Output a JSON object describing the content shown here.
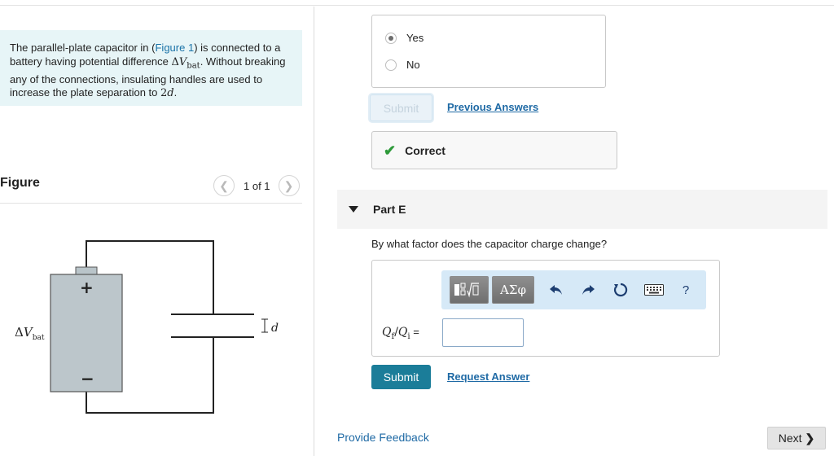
{
  "problem": {
    "text_before_link": "The parallel-plate capacitor in (",
    "link_label": "Figure 1",
    "text_after_link": ") is connected to a battery having potential difference ",
    "vbat_delta": "Δ",
    "vbat_symbol": "V",
    "vbat_sub": "bat",
    "text_mid": ". Without breaking any of the connections, insulating handles are used to increase the plate separation to ",
    "sep_value": "2",
    "sep_var": "d",
    "text_end": "."
  },
  "figure": {
    "label": "Figure",
    "pager_count": "1 of 1",
    "diagram": {
      "battery_plus": "+",
      "battery_minus": "−",
      "voltage_delta": "Δ",
      "voltage_symbol": "V",
      "voltage_sub": "bat",
      "gap_label": "d"
    }
  },
  "previous_part": {
    "options": [
      {
        "label": "Yes",
        "selected": true
      },
      {
        "label": "No",
        "selected": false
      }
    ],
    "submit_label": "Submit",
    "previous_answers_label": "Previous Answers",
    "result_label": "Correct"
  },
  "part_e": {
    "title": "Part E",
    "question": "By what factor does the capacitor charge change?",
    "toolbar": {
      "template_icons": "template-fraction-sqrt",
      "greek_label": "ΑΣφ",
      "help_label": "?"
    },
    "answer_q": "Q",
    "answer_f": "f",
    "answer_slash": "/",
    "answer_i": "i",
    "answer_eq": "=",
    "answer_value": "",
    "submit_label": "Submit",
    "request_answer_label": "Request Answer"
  },
  "footer": {
    "feedback_label": "Provide Feedback",
    "next_label": "Next"
  },
  "colors": {
    "link": "#1f6aa5",
    "submit": "#1b7d99",
    "correct": "#2e9a3a",
    "problem_bg": "#e7f5f7",
    "toolbar_bg": "#d6e9f7"
  }
}
